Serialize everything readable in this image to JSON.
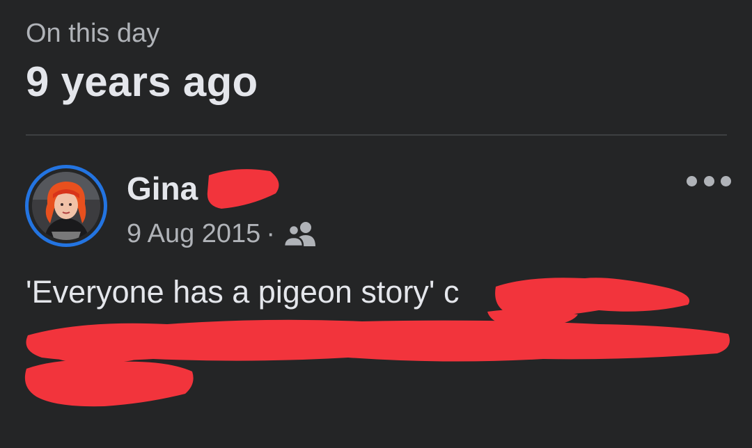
{
  "memory": {
    "eyebrow": "On this day",
    "headline": "9 years ago"
  },
  "post": {
    "author_name": "Gina",
    "date": "9 Aug 2015",
    "separator": "·",
    "audience_icon": "friends-icon",
    "text": "'Everyone has a pigeon story' c",
    "more_icon": "more-options-icon"
  },
  "colors": {
    "background": "#242526",
    "primary_text": "#e4e6eb",
    "secondary_text": "#b0b3b8",
    "avatar_ring": "#2374e1",
    "redaction": "#f2343c"
  }
}
